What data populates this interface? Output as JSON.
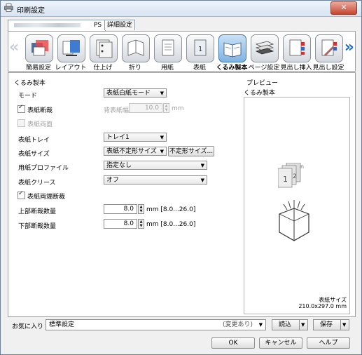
{
  "window": {
    "title": "印刷設定",
    "close_label": "✕"
  },
  "tabs": {
    "ps_label": "PS",
    "detail_label": "詳細設定"
  },
  "categories": [
    {
      "label": "簡易設定",
      "icon": "quick-setting-icon"
    },
    {
      "label": "レイアウト",
      "icon": "layout-icon"
    },
    {
      "label": "仕上げ",
      "icon": "finishing-icon"
    },
    {
      "label": "折り",
      "icon": "fold-icon"
    },
    {
      "label": "用紙",
      "icon": "paper-icon"
    },
    {
      "label": "表紙",
      "icon": "cover-icon"
    },
    {
      "label": "くるみ製本",
      "icon": "perfect-binding-icon",
      "selected": true
    },
    {
      "label": "ページ設定",
      "icon": "page-setting-icon"
    },
    {
      "label": "見出し挿入",
      "icon": "tab-insert-icon"
    },
    {
      "label": "見出し設定",
      "icon": "tab-setting-icon"
    }
  ],
  "binding": {
    "group_title": "くるみ製本",
    "mode_label": "モード",
    "mode_value": "表紙白紙モード",
    "cover_trim_label": "表紙断裁",
    "cover_trim_checked": true,
    "spine_width_label": "背表紙幅",
    "spine_width_value": "10.0",
    "spine_width_unit": "mm",
    "cover_print_label": "表紙両面",
    "cover_print_checked": false,
    "cover_tray_label": "表紙トレイ",
    "cover_tray_value": "トレイ1",
    "cover_size_label": "表紙サイズ",
    "cover_size_value": "表紙不定形サイズ",
    "custom_size_button": "不定形サイズ...",
    "paper_profile_label": "用紙プロファイル",
    "paper_profile_value": "指定なし",
    "cover_crease_label": "表紙クリース",
    "cover_crease_value": "オフ",
    "both_edge_trim_label": "表紙両端断裁",
    "both_edge_trim_checked": true,
    "top_trim_label": "上部断裁数量",
    "top_trim_value": "8.0",
    "top_trim_unit": "mm [8.0...26.0]",
    "bottom_trim_label": "下部断裁数量",
    "bottom_trim_value": "8.0",
    "bottom_trim_unit": "mm [8.0...26.0]"
  },
  "preview": {
    "title": "プレビュー",
    "subtitle": "くるみ製本",
    "size_label": "表紙サイズ",
    "size_value": "210.0x297.0 mm",
    "page_numbers": [
      "1",
      "2",
      "n"
    ]
  },
  "favorites": {
    "label": "お気に入り",
    "value": "標準設定",
    "changed": "(変更あり)",
    "load_button": "読込",
    "save_button": "保存"
  },
  "footer": {
    "ok": "OK",
    "cancel": "キャンセル",
    "help": "ヘルプ"
  }
}
